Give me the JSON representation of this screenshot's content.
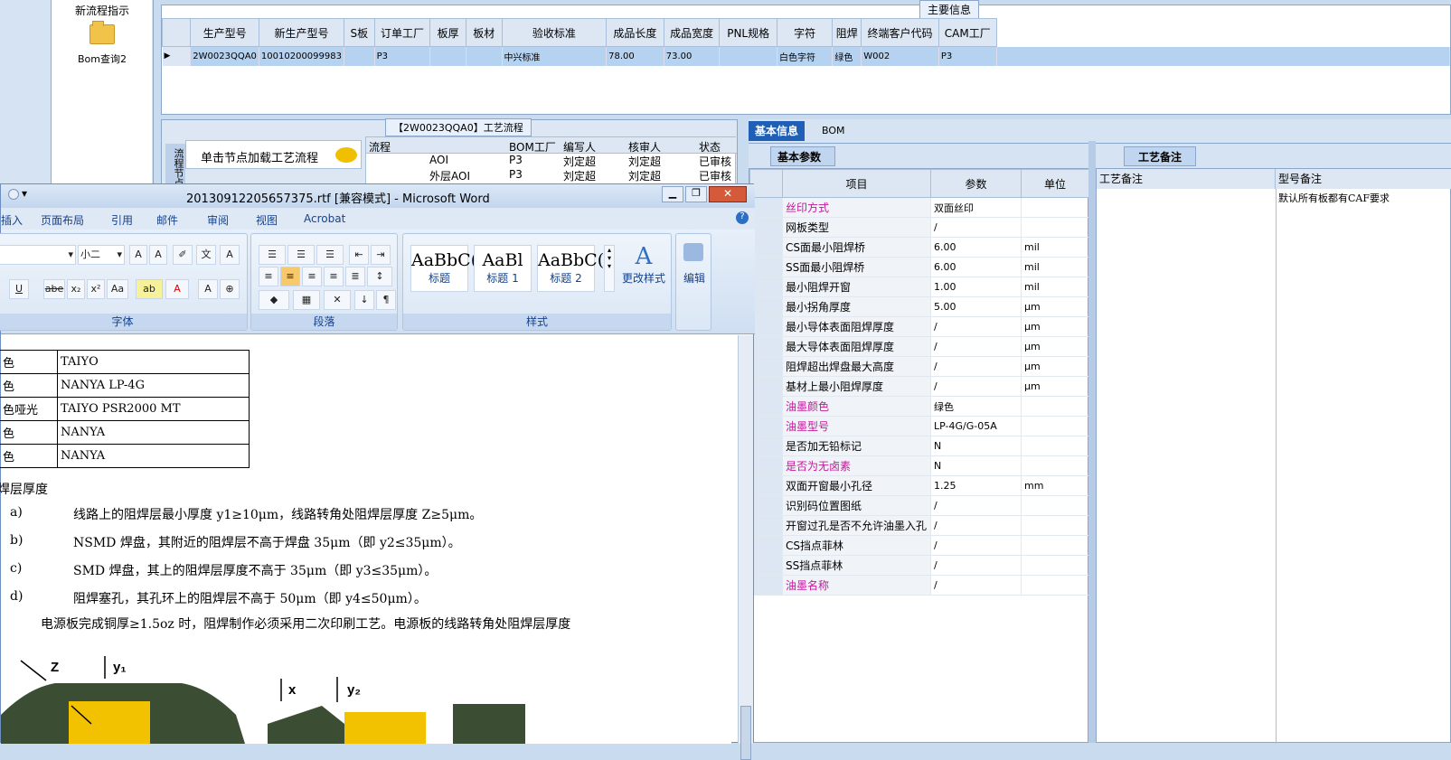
{
  "nav": {
    "item1": "新流程指示",
    "item2": "Bom查询2"
  },
  "top_grid": {
    "caption": "主要信息",
    "headers": [
      "生产型号",
      "新生产型号",
      "S板",
      "订单工厂",
      "板厚",
      "板材",
      "验收标准",
      "成品长度",
      "成品宽度",
      "PNL规格",
      "字符",
      "阻焊",
      "终端客户代码",
      "CAM工厂"
    ],
    "row": [
      "2W0023QQA0",
      "10010200099983",
      "",
      "P3",
      "",
      "",
      "中兴标准",
      "78.00",
      "73.00",
      "",
      "白色字符",
      "绿色",
      "W002",
      "P3"
    ]
  },
  "process": {
    "caption": "【2W0023QQA0】工艺流程",
    "tip": "单击节点加载工艺流程",
    "side_label": "流程节点",
    "headers": [
      "流程",
      "BOM工厂",
      "编写人",
      "核审人",
      "状态"
    ],
    "rows": [
      {
        "name": "AOI",
        "factory": "P3",
        "writer": "刘定超",
        "checker": "刘定超",
        "status": "已审核"
      },
      {
        "name": "外层AOI",
        "factory": "P3",
        "writer": "刘定超",
        "checker": "刘定超",
        "status": "已审核"
      }
    ]
  },
  "word": {
    "title": "20130912205657375.rtf [兼容模式] - Microsoft Word",
    "menu": [
      "插入",
      "页面布局",
      "引用",
      "邮件",
      "审阅",
      "视图",
      "Acrobat"
    ],
    "font_size": "小二",
    "groups": {
      "font": "字体",
      "para": "段落",
      "styles": "样式",
      "edit": "编辑"
    },
    "styles": [
      {
        "preview": "AaBbC(",
        "name": "标题"
      },
      {
        "preview": "AaBl",
        "name": "标题 1"
      },
      {
        "preview": "AaBbC(",
        "name": "标题 2"
      }
    ],
    "change_styles": "更改样式",
    "table": [
      [
        "色",
        "TAIYO"
      ],
      [
        "色",
        "NANYA  LP-4G"
      ],
      [
        "色哑光",
        "TAIYO    PSR2000 MT"
      ],
      [
        "色",
        "NANYA"
      ],
      [
        "色",
        "NANYA"
      ]
    ],
    "heading": "焊层厚度",
    "items": [
      {
        "label": "a)",
        "text": "线路上的阻焊层最小厚度 y1≥10μm，线路转角处阻焊层厚度 Z≥5μm。"
      },
      {
        "label": "b)",
        "text": "NSMD 焊盘，其附近的阻焊层不高于焊盘 35μm（即 y2≤35μm）。"
      },
      {
        "label": "c)",
        "text": "SMD 焊盘，其上的阻焊层厚度不高于 35μm（即 y3≤35μm）。"
      },
      {
        "label": "d)",
        "text": "阻焊塞孔，其孔环上的阻焊层不高于 50μm（即 y4≤50μm）。"
      }
    ],
    "note": "电源板完成铜厚≥1.5oz 时，阻焊制作必须采用二次印刷工艺。电源板的线路转角处阻焊层厚度",
    "fig": {
      "z": "Z",
      "y1": "y₁",
      "x": "x",
      "y2": "y₂"
    }
  },
  "right": {
    "tabs": [
      "基本信息",
      "BOM"
    ],
    "subtab": "基本参数",
    "notes_tab": "工艺备注",
    "headers": [
      "项目",
      "参数",
      "单位"
    ],
    "notes_headers": [
      "工艺备注",
      "型号备注"
    ],
    "notes_text": "默认所有板都有CAF要求",
    "rows": [
      {
        "item": "丝印方式",
        "value": "双面丝印",
        "unit": "",
        "pink": true
      },
      {
        "item": "网板类型",
        "value": "/",
        "unit": ""
      },
      {
        "item": "CS面最小阻焊桥",
        "value": "6.00",
        "unit": "mil"
      },
      {
        "item": "SS面最小阻焊桥",
        "value": "6.00",
        "unit": "mil"
      },
      {
        "item": "最小阻焊开窗",
        "value": "1.00",
        "unit": "mil"
      },
      {
        "item": "最小拐角厚度",
        "value": "5.00",
        "unit": "μm"
      },
      {
        "item": "最小导体表面阻焊厚度",
        "value": "/",
        "unit": "μm"
      },
      {
        "item": "最大导体表面阻焊厚度",
        "value": "/",
        "unit": "μm"
      },
      {
        "item": "阻焊超出焊盘最大高度",
        "value": "/",
        "unit": "μm"
      },
      {
        "item": "基材上最小阻焊厚度",
        "value": "/",
        "unit": "μm"
      },
      {
        "item": "油墨颜色",
        "value": "绿色",
        "unit": "",
        "pink": true
      },
      {
        "item": "油墨型号",
        "value": "LP-4G/G-05A",
        "unit": "",
        "pink": true
      },
      {
        "item": "是否加无铅标记",
        "value": "N",
        "unit": ""
      },
      {
        "item": "是否为无卤素",
        "value": "N",
        "unit": "",
        "pink": true
      },
      {
        "item": "双面开窗最小孔径",
        "value": "1.25",
        "unit": "mm"
      },
      {
        "item": "识别码位置图纸",
        "value": "/",
        "unit": ""
      },
      {
        "item": "开窗过孔是否不允许油墨入孔",
        "value": "/",
        "unit": ""
      },
      {
        "item": "CS挡点菲林",
        "value": "/",
        "unit": ""
      },
      {
        "item": "SS挡点菲林",
        "value": "/",
        "unit": ""
      },
      {
        "item": "油墨名称",
        "value": "/",
        "unit": "",
        "pink": true
      }
    ]
  }
}
